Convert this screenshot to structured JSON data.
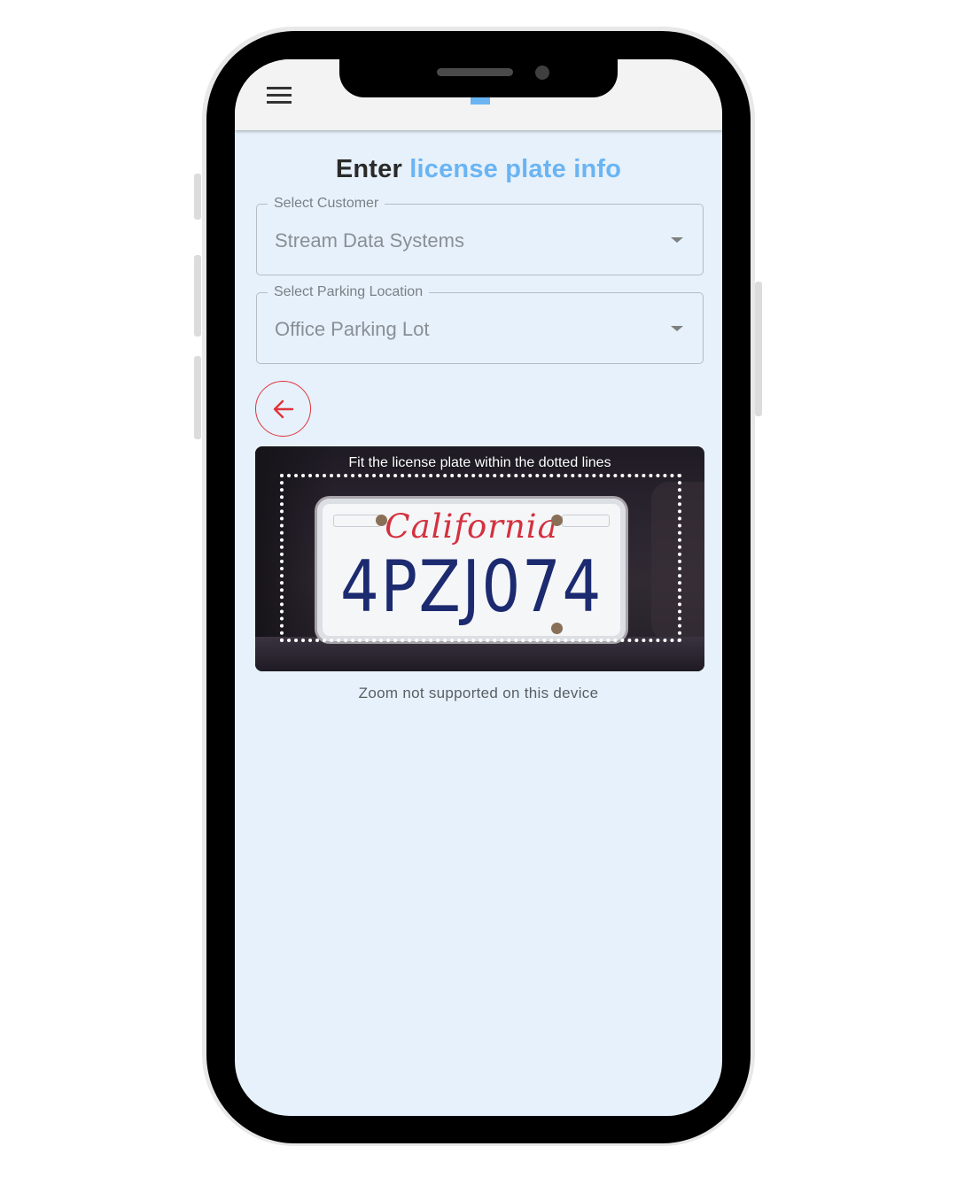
{
  "header": {
    "menu_icon": "hamburger-menu-icon"
  },
  "page": {
    "title_prefix": "Enter",
    "title_accent": "license plate info",
    "accent_color": "#6ab4f3"
  },
  "form": {
    "customer": {
      "label": "Select Customer",
      "value": "Stream Data Systems"
    },
    "location": {
      "label": "Select Parking Location",
      "value": "Office Parking Lot"
    }
  },
  "back_button": {
    "icon": "arrow-left-icon",
    "color": "#e0343b"
  },
  "camera": {
    "hint": "Fit the license plate within the dotted lines",
    "plate_state": "California",
    "plate_number": "4PZJ074",
    "zoom_note": "Zoom not supported on this device"
  }
}
